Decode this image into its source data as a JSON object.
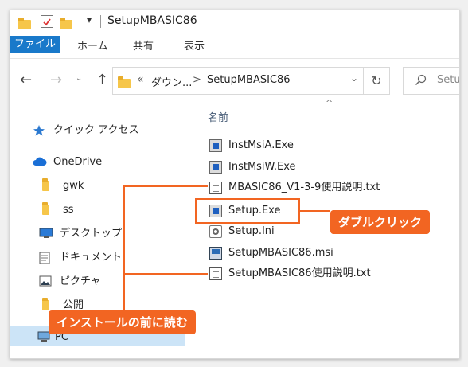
{
  "window": {
    "title": "SetupMBASIC86",
    "qat_dropdown": "▾"
  },
  "ribbon": {
    "tabs": [
      "ファイル",
      "ホーム",
      "共有",
      "表示"
    ]
  },
  "nav": {
    "back": "←",
    "forward": "→",
    "up": "↑"
  },
  "address": {
    "overflow": "«",
    "crumbs": [
      "ダウン...",
      "SetupMBASIC86"
    ],
    "sep": ">",
    "dropdown": "⌄",
    "refresh": "↻"
  },
  "search": {
    "placeholder": "Setu"
  },
  "sidebar": {
    "items": [
      {
        "label": "クイック アクセス",
        "icon": "star-icon"
      },
      {
        "label": "OneDrive",
        "icon": "cloud-icon"
      },
      {
        "label": "gwk",
        "icon": "folder-icon"
      },
      {
        "label": "ss",
        "icon": "folder-icon"
      },
      {
        "label": "デスクトップ",
        "icon": "desktop-icon"
      },
      {
        "label": "ドキュメント",
        "icon": "document-icon"
      },
      {
        "label": "ピクチャ",
        "icon": "picture-icon"
      },
      {
        "label": "公開",
        "icon": "folder-icon"
      },
      {
        "label": "PC",
        "icon": "pc-icon"
      }
    ]
  },
  "filelist": {
    "column_header": "名前",
    "sort_indicator": "^",
    "files": [
      {
        "name": "InstMsiA.Exe",
        "type": "exe"
      },
      {
        "name": "InstMsiW.Exe",
        "type": "exe"
      },
      {
        "name": "MBASIC86_V1-3-9使用説明.txt",
        "type": "txt"
      },
      {
        "name": "Setup.Exe",
        "type": "exe"
      },
      {
        "name": "Setup.Ini",
        "type": "ini"
      },
      {
        "name": "SetupMBASIC86.msi",
        "type": "msi"
      },
      {
        "name": "SetupMBASIC86使用説明.txt",
        "type": "txt"
      }
    ]
  },
  "annotations": {
    "double_click": "ダブルクリック",
    "read_before_install": "インストールの前に読む",
    "color": "#f26522"
  }
}
